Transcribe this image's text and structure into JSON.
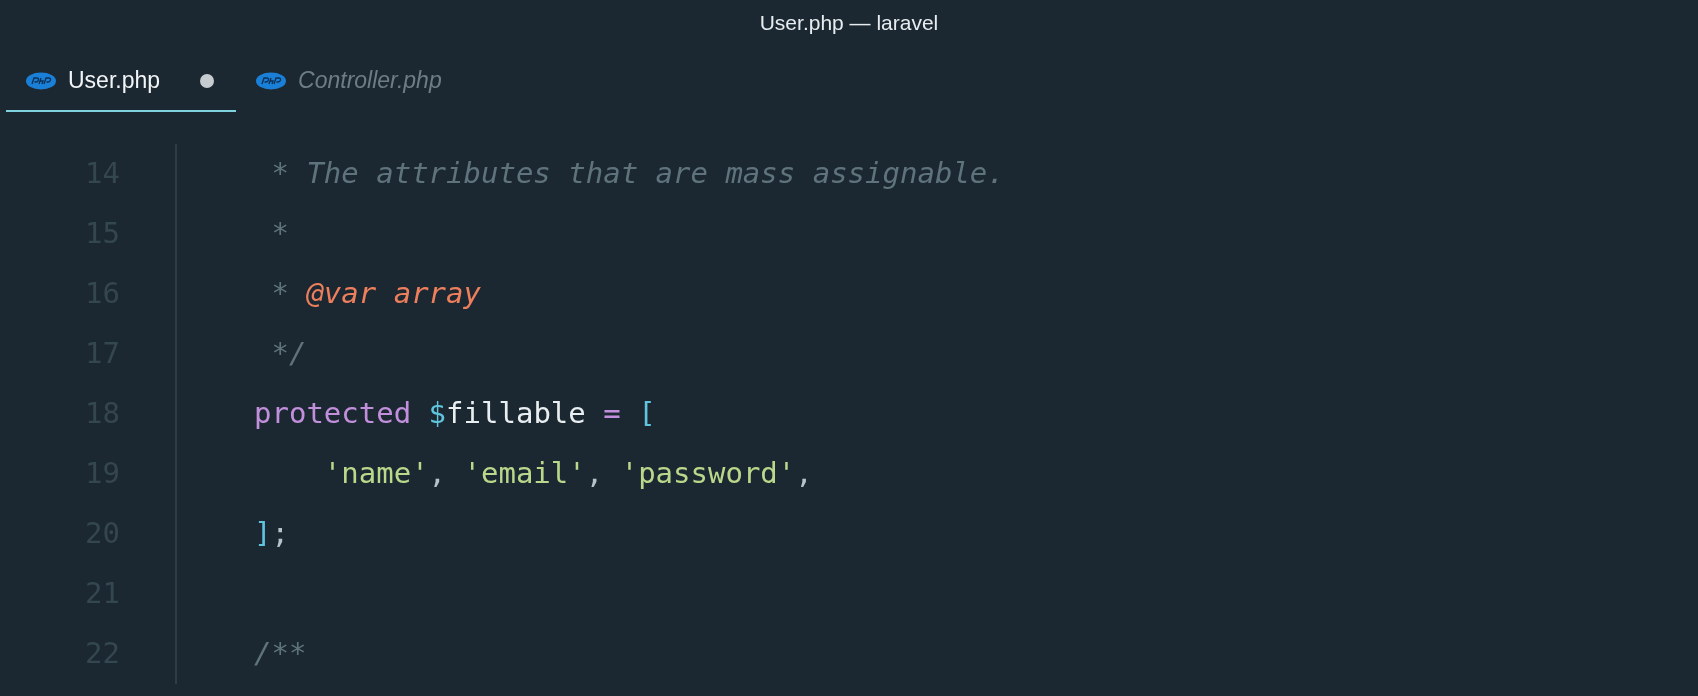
{
  "window": {
    "title": "User.php — laravel"
  },
  "tabs": [
    {
      "label": "User.php",
      "selected": true,
      "modified": true,
      "preview": false
    },
    {
      "label": "Controller.php",
      "selected": false,
      "modified": false,
      "preview": true
    }
  ],
  "editor": {
    "lines": [
      {
        "number": "14",
        "tokens": [
          {
            "text": " * The attributes that are mass assignable.",
            "kind": "comment"
          }
        ]
      },
      {
        "number": "15",
        "tokens": [
          {
            "text": " *",
            "kind": "comment"
          }
        ]
      },
      {
        "number": "16",
        "tokens": [
          {
            "text": " * ",
            "kind": "comment"
          },
          {
            "text": "@var array",
            "kind": "tag"
          }
        ]
      },
      {
        "number": "17",
        "tokens": [
          {
            "text": " */",
            "kind": "comment"
          }
        ]
      },
      {
        "number": "18",
        "tokens": [
          {
            "text": "protected ",
            "kind": "keyword"
          },
          {
            "text": "$",
            "kind": "sigil"
          },
          {
            "text": "fillable ",
            "kind": "variable"
          },
          {
            "text": "= ",
            "kind": "operator"
          },
          {
            "text": "[",
            "kind": "bracket"
          }
        ]
      },
      {
        "number": "19",
        "tokens": [
          {
            "text": "    'name'",
            "kind": "string"
          },
          {
            "text": ", ",
            "kind": "punct"
          },
          {
            "text": "'email'",
            "kind": "string"
          },
          {
            "text": ", ",
            "kind": "punct"
          },
          {
            "text": "'password'",
            "kind": "string"
          },
          {
            "text": ",",
            "kind": "punct"
          }
        ]
      },
      {
        "number": "20",
        "tokens": [
          {
            "text": "]",
            "kind": "bracket"
          },
          {
            "text": ";",
            "kind": "punct"
          }
        ]
      },
      {
        "number": "21"
      },
      {
        "number": "22",
        "tokens": [
          {
            "text": "/**",
            "kind": "comment"
          }
        ]
      }
    ]
  }
}
